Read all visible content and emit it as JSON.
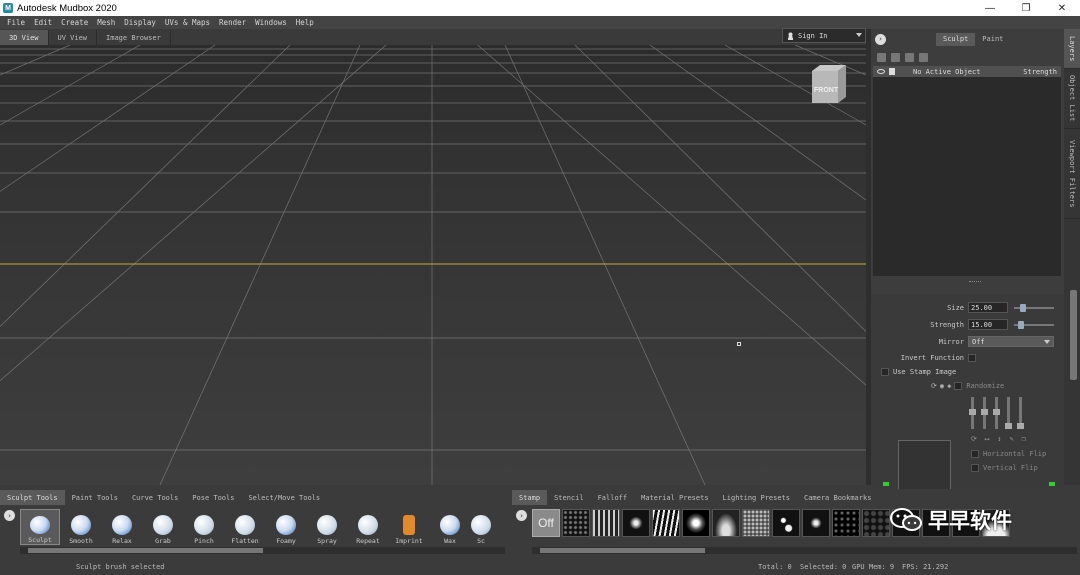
{
  "window": {
    "title": "Autodesk Mudbox 2020",
    "controls": [
      "—",
      "❐",
      "✕"
    ]
  },
  "menu": [
    "File",
    "Edit",
    "Create",
    "Mesh",
    "Display",
    "UVs & Maps",
    "Render",
    "Windows",
    "Help"
  ],
  "view_tabs": [
    {
      "label": "3D View",
      "active": true
    },
    {
      "label": "UV View",
      "active": false
    },
    {
      "label": "Image Browser",
      "active": false
    }
  ],
  "sign_in": {
    "label": "Sign In"
  },
  "viewcube": {
    "face_label": "FRONT"
  },
  "right_panel": {
    "tabs": [
      {
        "label": "Sculpt",
        "active": true
      },
      {
        "label": "Paint",
        "active": false
      }
    ],
    "layer_header": {
      "name": "No Active Object",
      "strength": "Strength"
    },
    "props": {
      "size_label": "Size",
      "size_value": "25.00",
      "strength_label": "Strength",
      "strength_value": "15.00",
      "mirror_label": "Mirror",
      "mirror_value": "Off",
      "invert_label": "Invert Function",
      "use_stamp_label": "Use Stamp Image",
      "randomize_label": "Randomize",
      "hflip_label": "Horizontal Flip",
      "vflip_label": "Vertical Flip"
    }
  },
  "side_tabs": [
    "Layers",
    "Object List",
    "Viewport Filters"
  ],
  "tool_tabs": [
    {
      "label": "Sculpt Tools",
      "active": true
    },
    {
      "label": "Paint Tools",
      "active": false
    },
    {
      "label": "Curve Tools",
      "active": false
    },
    {
      "label": "Pose Tools",
      "active": false
    },
    {
      "label": "Select/Move Tools",
      "active": false
    }
  ],
  "tools": [
    "Sculpt",
    "Smooth",
    "Relax",
    "Grab",
    "Pinch",
    "Flatten",
    "Foamy",
    "Spray",
    "Repeat",
    "Imprint",
    "Wax",
    "Sc"
  ],
  "stamp_tabs": [
    {
      "label": "Stamp",
      "active": true
    },
    {
      "label": "Stencil",
      "active": false
    },
    {
      "label": "Falloff",
      "active": false
    },
    {
      "label": "Material Presets",
      "active": false
    },
    {
      "label": "Lighting Presets",
      "active": false
    },
    {
      "label": "Camera Bookmarks",
      "active": false
    }
  ],
  "stamp_off_label": "Off",
  "status": {
    "left": "Sculpt brush selected",
    "total": "Total: 0",
    "selected": "Selected: 0",
    "gpu": "GPU Mem: 9",
    "fps": "FPS: 21.292"
  },
  "watermark": {
    "text": "早早软件"
  },
  "colors": {
    "accent_horizon": "#c9a93a",
    "panel_bg": "#3d3d3d",
    "active_tab": "#5a5a5a"
  }
}
